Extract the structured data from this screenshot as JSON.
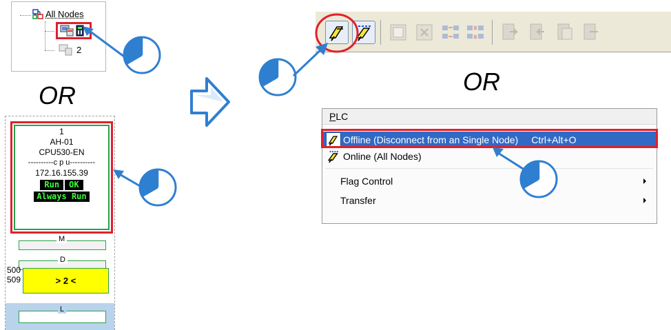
{
  "tree": {
    "root_label": "All Nodes",
    "child2_label": "2"
  },
  "or_labels": {
    "left": "OR",
    "right": "OR"
  },
  "cpu": {
    "index": "1",
    "model_family": "AH-01",
    "model": "CPU530-EN",
    "cpu_text": "c p u",
    "ip": "172.16.155.39",
    "status_run": "Run",
    "status_ok": "OK",
    "status_mode": "Always Run",
    "slot_m": "M",
    "slot_d": "D",
    "slot_l": "L",
    "addr_top": "500",
    "addr_bottom": "509",
    "badge": "> 2 <"
  },
  "menu": {
    "title": "PLC",
    "title_underline": "P",
    "title_rest": "LC",
    "items": [
      {
        "label": "Offline (Disconnect from an Single Node)",
        "shortcut": "Ctrl+Alt+O",
        "icon": "plug-offline-icon",
        "selected": true
      },
      {
        "label": "Online (All Nodes)",
        "shortcut": "",
        "icon": "plug-online-icon",
        "selected": false
      },
      {
        "label": "Flag Control",
        "shortcut": "",
        "icon": "",
        "submenu": true
      },
      {
        "label": "Transfer",
        "shortcut": "",
        "icon": "",
        "submenu": true
      }
    ]
  },
  "colors": {
    "highlight_red": "#e0202c",
    "arrow_blue": "#2f7fd0",
    "menu_selected": "#316ac5",
    "module_green": "#2aa04a",
    "badge_yellow": "#ffff00"
  }
}
